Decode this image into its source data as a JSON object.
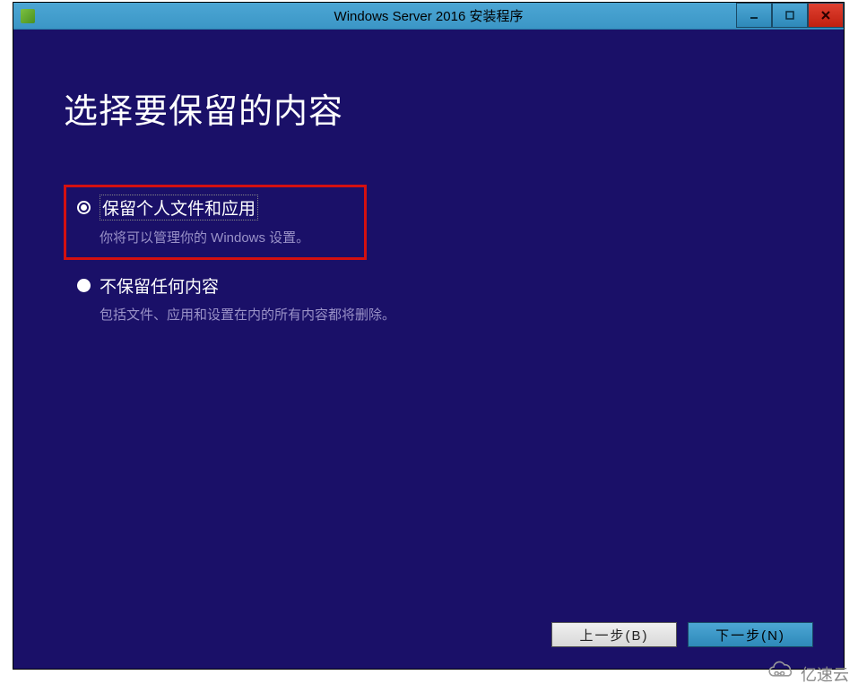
{
  "titlebar": {
    "title": "Windows Server 2016 安装程序"
  },
  "heading": "选择要保留的内容",
  "options": [
    {
      "title": "保留个人文件和应用",
      "description": "你将可以管理你的 Windows 设置。",
      "selected": true,
      "highlighted": true
    },
    {
      "title": "不保留任何内容",
      "description": "包括文件、应用和设置在内的所有内容都将删除。",
      "selected": false,
      "highlighted": false
    }
  ],
  "buttons": {
    "back": "上一步(B)",
    "next": "下一步(N)"
  },
  "watermark": {
    "text": "亿速云"
  }
}
